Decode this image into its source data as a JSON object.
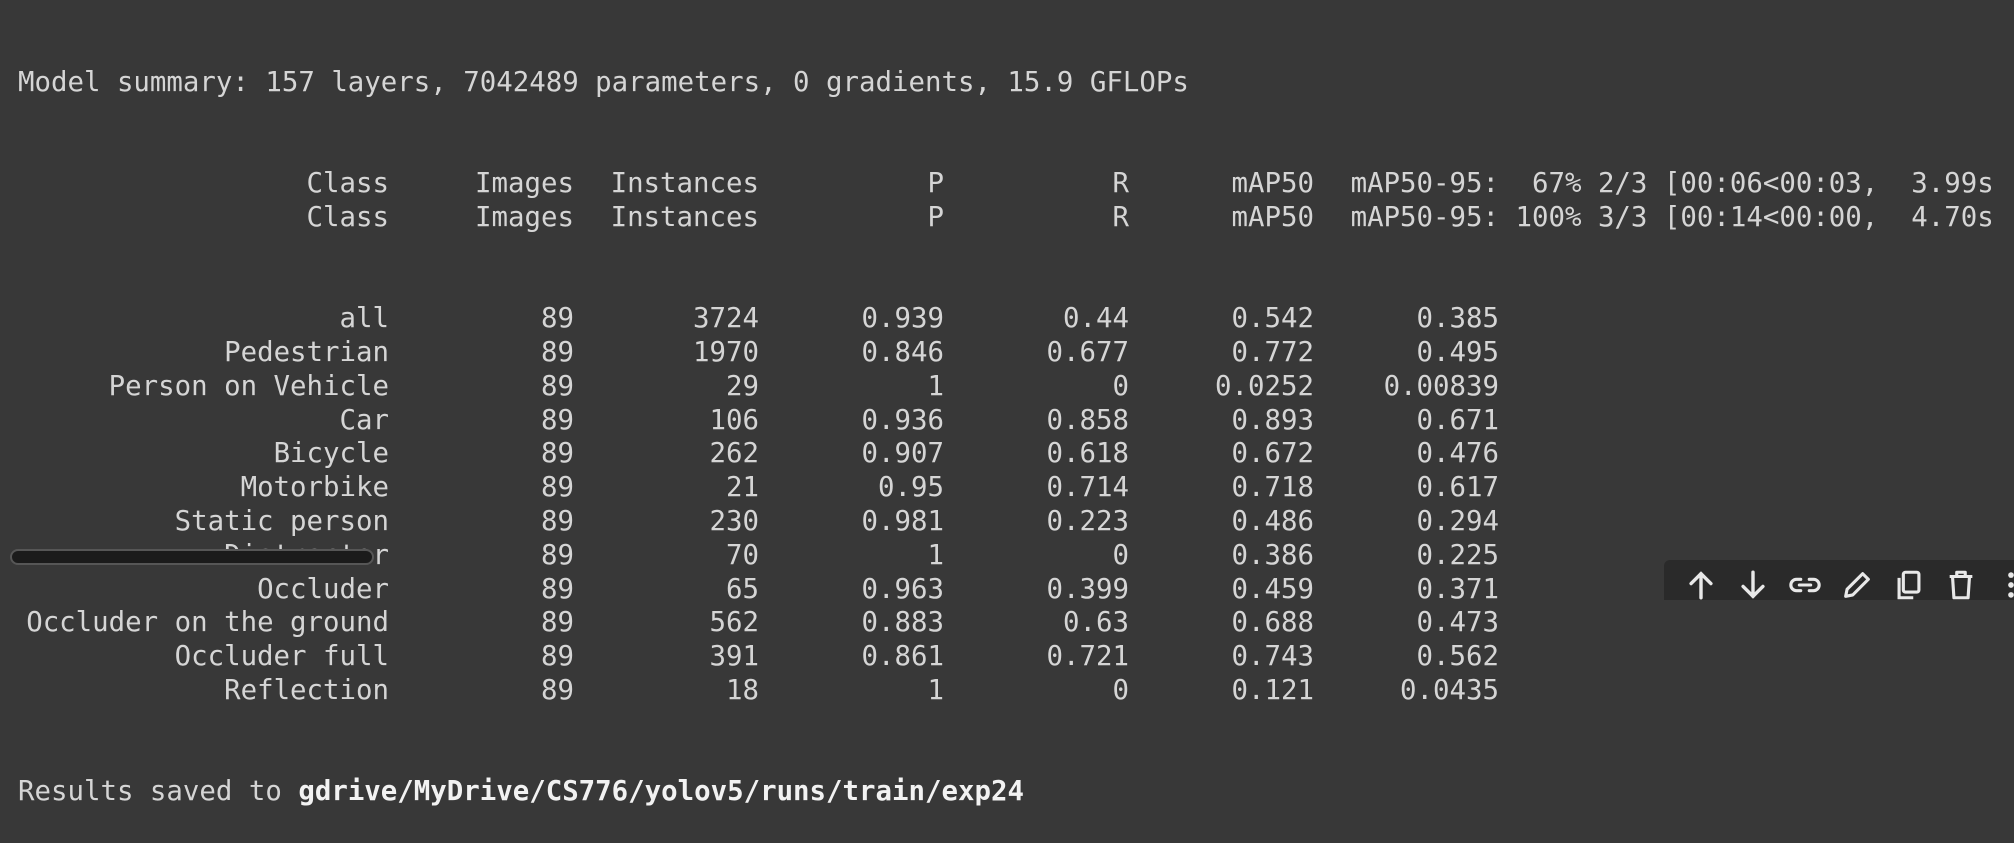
{
  "summary_line": "Model summary: 157 layers, 7042489 parameters, 0 gradients, 15.9 GFLOPs",
  "header_rows": [
    {
      "class": "Class",
      "images": "Images",
      "instances": "Instances",
      "p": "P",
      "r": "R",
      "map50": "mAP50",
      "map50_95": "mAP50-95:",
      "progress": "  67% 2/3 [00:06<00:03,  3.99s"
    },
    {
      "class": "Class",
      "images": "Images",
      "instances": "Instances",
      "p": "P",
      "r": "R",
      "map50": "mAP50",
      "map50_95": "mAP50-95:",
      "progress": " 100% 3/3 [00:14<00:00,  4.70s"
    }
  ],
  "rows": [
    {
      "class": "all",
      "images": "89",
      "instances": "3724",
      "p": "0.939",
      "r": "0.44",
      "map50": "0.542",
      "map50_95": "0.385"
    },
    {
      "class": "Pedestrian",
      "images": "89",
      "instances": "1970",
      "p": "0.846",
      "r": "0.677",
      "map50": "0.772",
      "map50_95": "0.495"
    },
    {
      "class": "Person on Vehicle",
      "images": "89",
      "instances": "29",
      "p": "1",
      "r": "0",
      "map50": "0.0252",
      "map50_95": "0.00839"
    },
    {
      "class": "Car",
      "images": "89",
      "instances": "106",
      "p": "0.936",
      "r": "0.858",
      "map50": "0.893",
      "map50_95": "0.671"
    },
    {
      "class": "Bicycle",
      "images": "89",
      "instances": "262",
      "p": "0.907",
      "r": "0.618",
      "map50": "0.672",
      "map50_95": "0.476"
    },
    {
      "class": "Motorbike",
      "images": "89",
      "instances": "21",
      "p": "0.95",
      "r": "0.714",
      "map50": "0.718",
      "map50_95": "0.617"
    },
    {
      "class": "Static person",
      "images": "89",
      "instances": "230",
      "p": "0.981",
      "r": "0.223",
      "map50": "0.486",
      "map50_95": "0.294"
    },
    {
      "class": "Distractor",
      "images": "89",
      "instances": "70",
      "p": "1",
      "r": "0",
      "map50": "0.386",
      "map50_95": "0.225"
    },
    {
      "class": "Occluder",
      "images": "89",
      "instances": "65",
      "p": "0.963",
      "r": "0.399",
      "map50": "0.459",
      "map50_95": "0.371"
    },
    {
      "class": "Occluder on the ground",
      "images": "89",
      "instances": "562",
      "p": "0.883",
      "r": "0.63",
      "map50": "0.688",
      "map50_95": "0.473"
    },
    {
      "class": "Occluder full",
      "images": "89",
      "instances": "391",
      "p": "0.861",
      "r": "0.721",
      "map50": "0.743",
      "map50_95": "0.562"
    },
    {
      "class": "Reflection",
      "images": "89",
      "instances": "18",
      "p": "1",
      "r": "0",
      "map50": "0.121",
      "map50_95": "0.0435"
    }
  ],
  "results_prefix": "Results saved to ",
  "results_path": "gdrive/MyDrive/CS776/yolov5/runs/train/exp24",
  "toolbar_icons": [
    "arrow-up-icon",
    "arrow-down-icon",
    "link-icon",
    "pencil-icon",
    "copy-icon",
    "trash-icon",
    "more-icon"
  ]
}
